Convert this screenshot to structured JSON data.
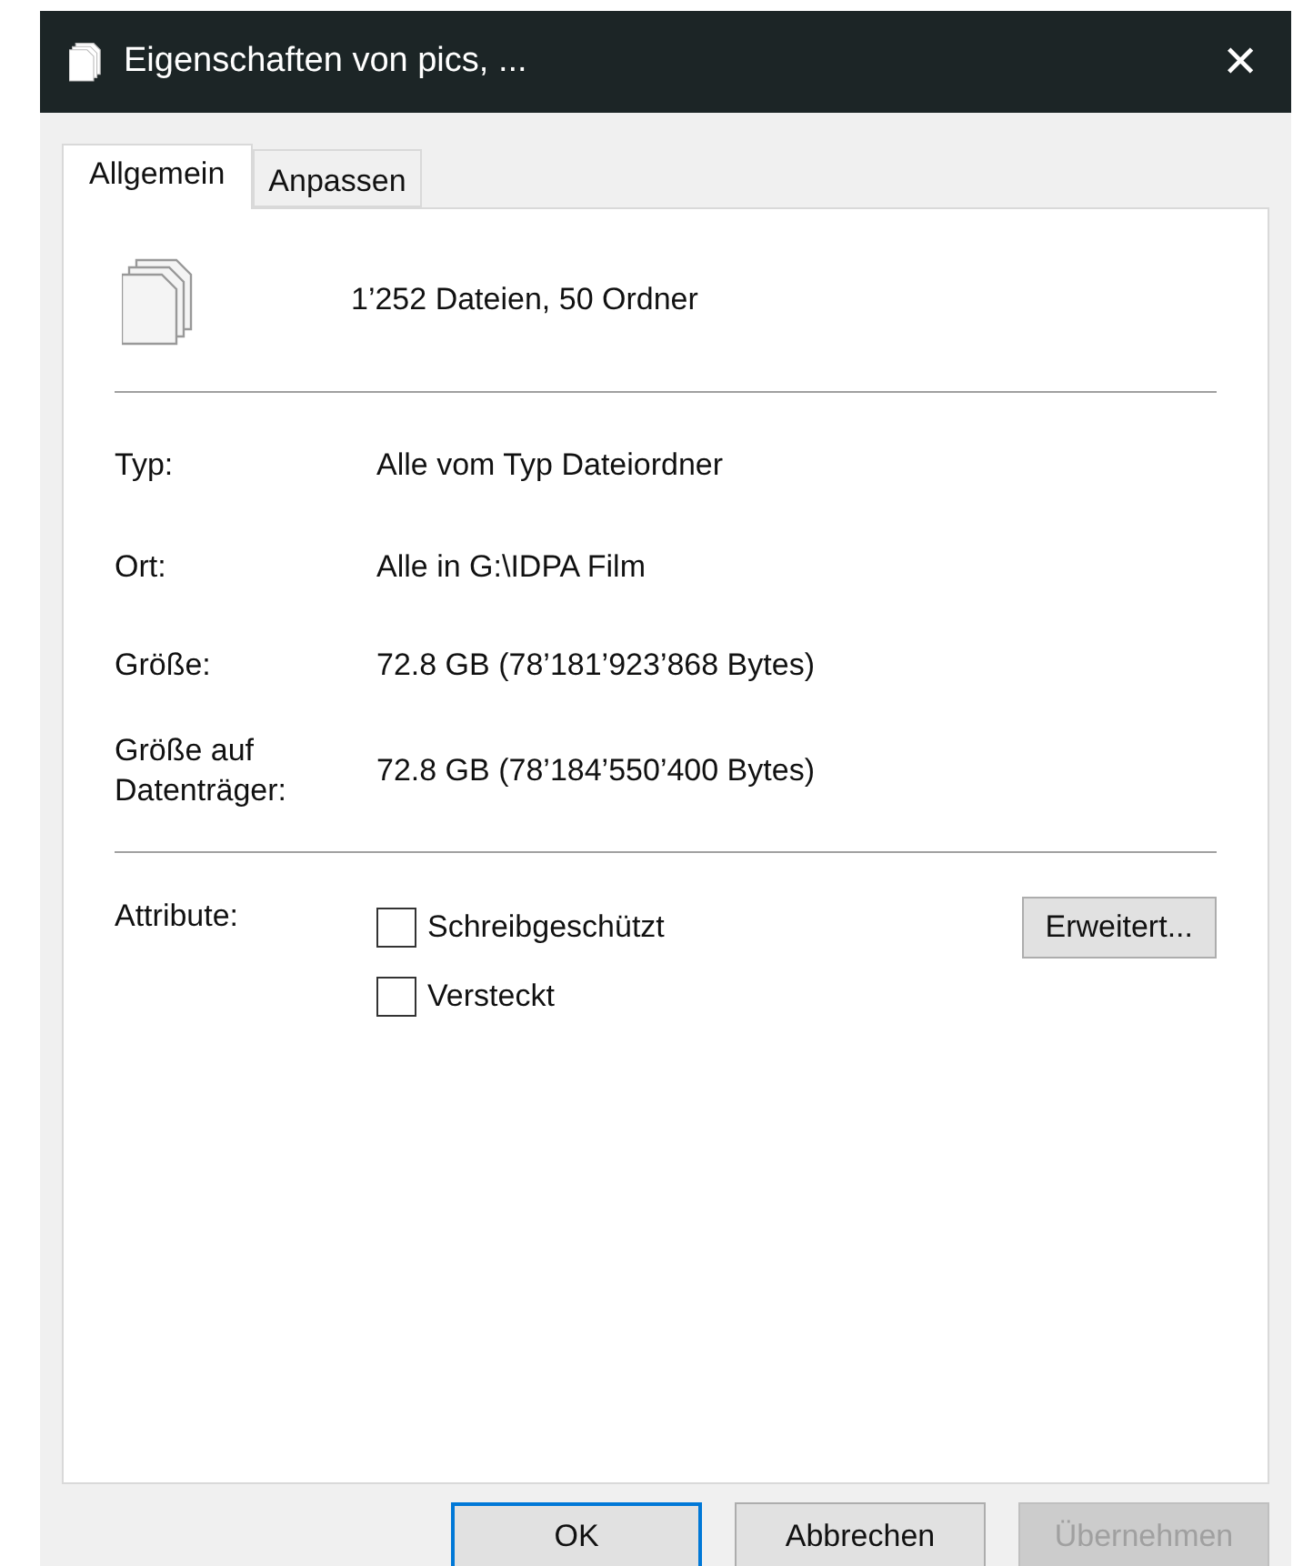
{
  "window": {
    "title": "Eigenschaften von pics, ...",
    "close": "✕"
  },
  "tabs": [
    {
      "label": "Allgemein",
      "selected": true
    },
    {
      "label": "Anpassen",
      "selected": false
    }
  ],
  "summary": "1’252 Dateien, 50 Ordner",
  "details": [
    {
      "label": "Typ:",
      "value": "Alle vom Typ Dateiordner"
    },
    {
      "label": "Ort:",
      "value": "Alle in G:\\IDPA Film"
    },
    {
      "label": "Größe:",
      "value": "72.8 GB (78’181’923’868 Bytes)"
    },
    {
      "label": "Größe auf Datenträger:",
      "value": "72.8 GB (78’184’550’400 Bytes)"
    }
  ],
  "attributes": {
    "label": "Attribute:",
    "options": [
      {
        "label": "Schreibgeschützt",
        "checked": false
      },
      {
        "label": "Versteckt",
        "checked": false
      }
    ],
    "advanced": "Erweitert..."
  },
  "buttons": [
    {
      "label": "OK",
      "default": true,
      "disabled": false
    },
    {
      "label": "Abbrechen",
      "default": false,
      "disabled": false
    },
    {
      "label": "Übernehmen",
      "default": false,
      "disabled": true
    }
  ]
}
